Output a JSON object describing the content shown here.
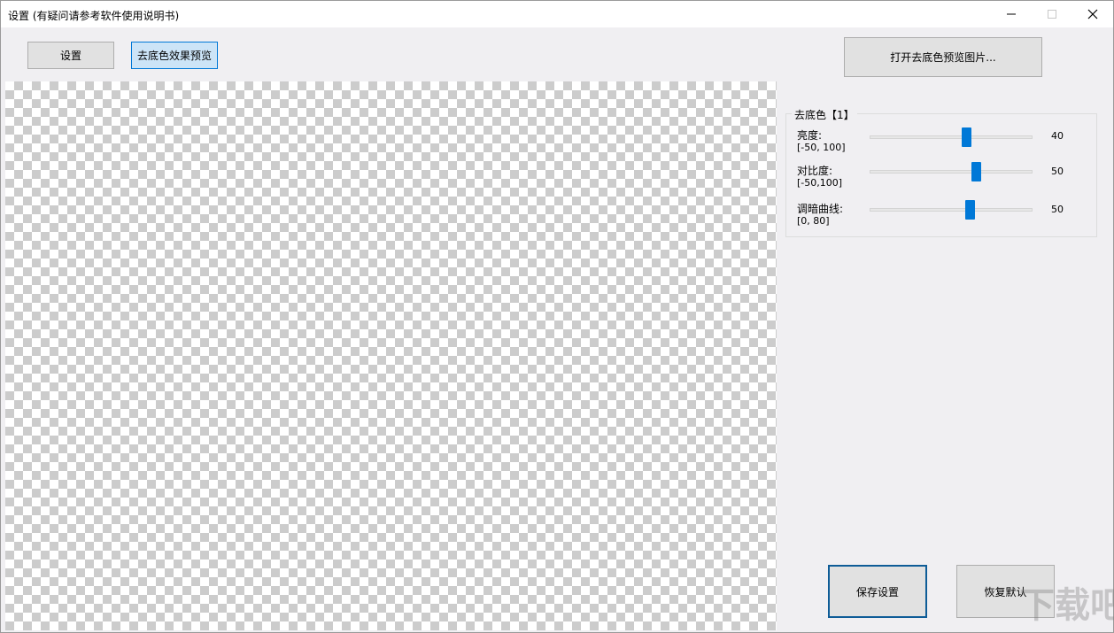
{
  "window": {
    "title": "设置 (有疑问请参考软件使用说明书)"
  },
  "toolbar": {
    "settings_label": "设置",
    "preview_label": "去底色效果预览",
    "open_preview_label": "打开去底色预览图片..."
  },
  "panel": {
    "group_title": "去底色【1】",
    "sliders": [
      {
        "label": "亮度:",
        "range": "[-50, 100]",
        "value": "40",
        "fraction": 0.6
      },
      {
        "label": "对比度:",
        "range": "[-50,100]",
        "value": "50",
        "fraction": 0.667
      },
      {
        "label": "调暗曲线:",
        "range": "[0, 80]",
        "value": "50",
        "fraction": 0.625
      }
    ]
  },
  "actions": {
    "save_label": "保存设置",
    "reset_label": "恢复默认"
  },
  "watermark": "下载吧",
  "colors": {
    "accent": "#0078d7",
    "button_bg": "#e1e1e1",
    "active_bg": "#cce4f7",
    "window_bg": "#f0eff2"
  }
}
